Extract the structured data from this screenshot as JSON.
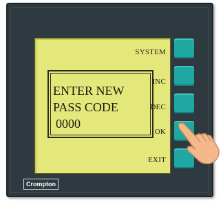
{
  "lcd": {
    "softkey_labels": [
      "SYSTEM",
      "INC",
      "DEC",
      "OK",
      "EXIT"
    ],
    "message": {
      "line1": "ENTER NEW",
      "line2": "PASS CODE",
      "code": "0000"
    }
  },
  "brand": {
    "logo_text": "Crompton"
  },
  "colors": {
    "bezel": "#2e3a40",
    "lcd_background": "#e4e77a",
    "key": "#1fa7a2",
    "skin": "#f3b98a"
  },
  "icons": [
    "pointing-hand-icon"
  ]
}
